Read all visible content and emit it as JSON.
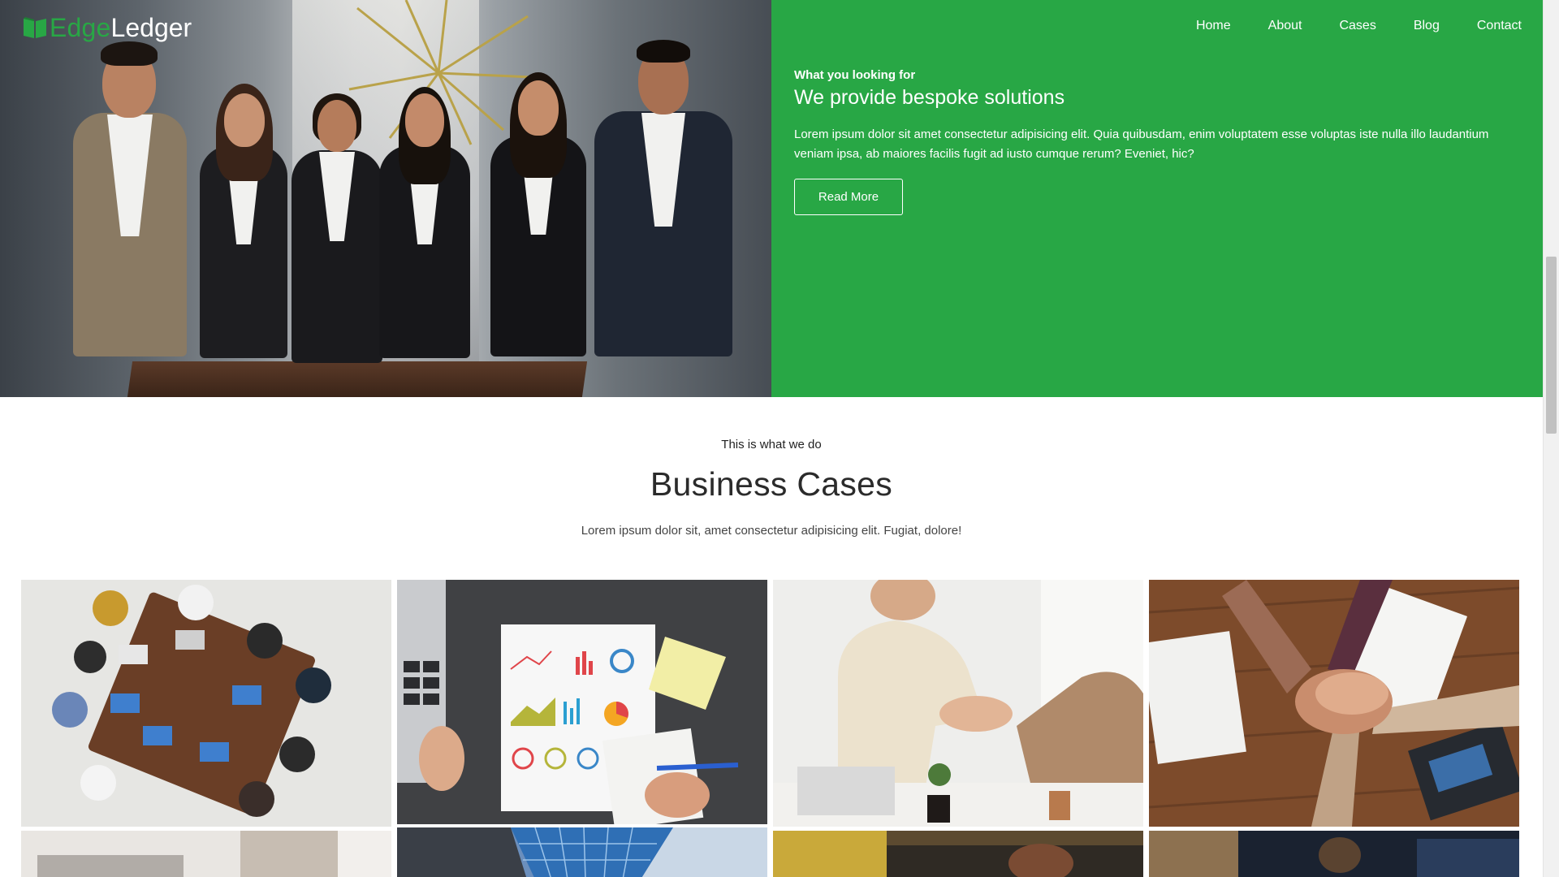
{
  "brand": {
    "part1": "Edge",
    "part2": "Ledger",
    "accent_color": "#28a745",
    "icon": "book-icon"
  },
  "nav": {
    "items": [
      "Home",
      "About",
      "Cases",
      "Blog",
      "Contact"
    ]
  },
  "hero": {
    "eyebrow": "What you looking for",
    "headline": "We provide bespoke solutions",
    "body": "Lorem ipsum dolor sit amet consectetur adipisicing elit. Quia quibusdam, enim voluptatem esse voluptas iste nulla illo laudantium veniam ipsa, ab maiores facilis fugit ad iusto cumque rerum? Eveniet, hic?",
    "button_label": "Read More",
    "panel_color": "#28a745",
    "photo": "team-photo"
  },
  "cases": {
    "eyebrow": "This is what we do",
    "title": "Business Cases",
    "subtitle": "Lorem ipsum dolor sit, amet consectetur adipisicing elit. Fugiat, dolore!",
    "tiles": [
      {
        "image": "meeting-table-overhead"
      },
      {
        "image": "charts-report-laptop"
      },
      {
        "image": "handshake-office"
      },
      {
        "image": "team-hands-stack"
      },
      {
        "image": "laptop-light-room"
      },
      {
        "image": "glass-skyscraper"
      },
      {
        "image": "cafe-workspace"
      },
      {
        "image": "dark-office-meeting"
      }
    ]
  }
}
